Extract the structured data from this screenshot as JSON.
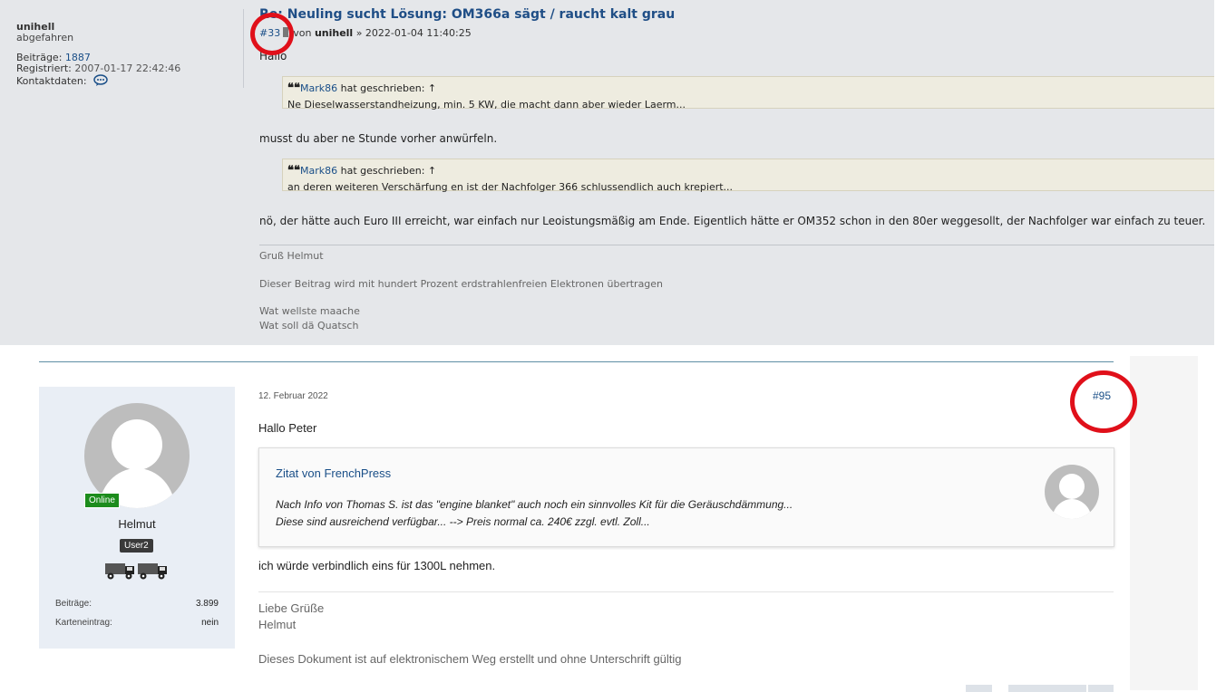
{
  "top_post": {
    "author": {
      "name": "unihell",
      "title": "abgefahren",
      "posts_label": "Beiträge:",
      "posts_value": "1887",
      "registered_label": "Registriert:",
      "registered_value": "2007-01-17 22:42:46",
      "contact_label": "Kontaktdaten:",
      "contact_icon": "chat-bubble-icon"
    },
    "title": "Re: Neuling sucht Lösung: OM366a sägt / raucht kalt grau",
    "post_number": "#33",
    "by_label": "von",
    "by_user": "unihell",
    "timestamp": "» 2022-01-04 11:40:25",
    "greeting": "Hallo",
    "quote1": {
      "mark": "❝❝",
      "user": "Mark86",
      "suffix": "hat geschrieben: ↑",
      "text": "Ne Dieselwasserstandheizung, min. 5 KW, die macht dann aber wieder Laerm..."
    },
    "paragraph1": "musst du aber ne Stunde vorher anwürfeln.",
    "quote2": {
      "mark": "❝❝",
      "user": "Mark86",
      "suffix": "hat geschrieben: ↑",
      "text": "an deren weiteren Verschärfung en ist der Nachfolger 366 schlussendlich auch krepiert..."
    },
    "paragraph2": "nö, der hätte auch Euro III erreicht, war einfach nur Leoistungsmäßig am Ende. Eigentlich hätte er OM352 schon in den 80er weggesollt, der Nachfolger war einfach zu teuer.",
    "signature": {
      "line1": "Gruß Helmut",
      "line2": "Dieser Beitrag wird mit hundert Prozent erdstrahlenfreien Elektronen übertragen",
      "line3": "Wat wellste maache",
      "line4": "Wat soll dä Quatsch"
    }
  },
  "bottom_post": {
    "author": {
      "online_badge": "Online",
      "name": "Helmut",
      "rank": "User2",
      "posts_label": "Beiträge:",
      "posts_value": "3.899",
      "map_label": "Karteneintrag:",
      "map_value": "nein"
    },
    "date": "12. Februar 2022",
    "post_number": "#95",
    "greeting": "Hallo Peter",
    "quote": {
      "title": "Zitat von FrenchPress",
      "line1": "Nach Info von Thomas S. ist das \"engine blanket\" auch noch ein sinnvolles Kit für die Geräuschdämmung...",
      "line2": "Diese sind ausreichend verfügbar... --> Preis normal ca. 240€ zzgl. evtl. Zoll..."
    },
    "body": "ich würde verbindlich eins für 1300L nehmen.",
    "signature": {
      "line1": "Liebe Grüße",
      "line2": "Helmut",
      "line3": "Dieses Dokument ist auf elektronischem Weg erstellt und ohne Unterschrift gültig"
    }
  },
  "colors": {
    "link": "#1a4f88",
    "annotation_red": "#e0101a",
    "online_green": "#1c8c1c",
    "top_background": "#e5e7ea",
    "quote_background": "#eeece0"
  }
}
